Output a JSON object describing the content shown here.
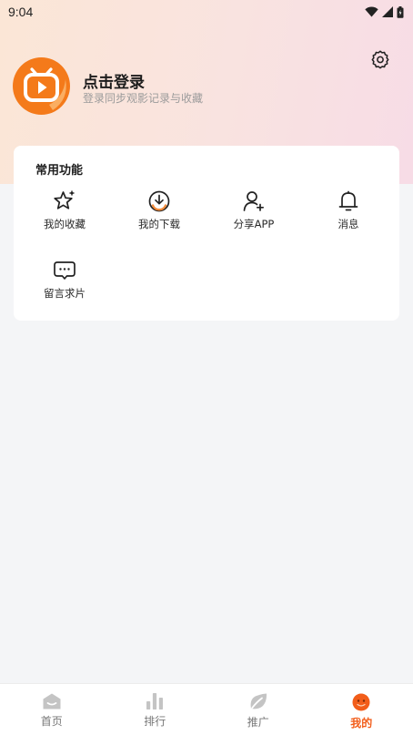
{
  "status_bar": {
    "time": "9:04"
  },
  "header": {
    "login_title": "点击登录",
    "login_subtitle": "登录同步观影记录与收藏"
  },
  "functions": {
    "title": "常用功能",
    "items": [
      {
        "label": "我的收藏",
        "icon": "star-sparkle-icon"
      },
      {
        "label": "我的下载",
        "icon": "download-icon"
      },
      {
        "label": "分享APP",
        "icon": "user-add-icon"
      },
      {
        "label": "消息",
        "icon": "bell-icon"
      },
      {
        "label": "留言求片",
        "icon": "chat-bubble-icon"
      }
    ]
  },
  "tabbar": {
    "items": [
      {
        "label": "首页",
        "icon": "home-icon"
      },
      {
        "label": "排行",
        "icon": "bar-chart-icon"
      },
      {
        "label": "推广",
        "icon": "leaf-icon"
      },
      {
        "label": "我的",
        "icon": "profile-face-icon",
        "active": true
      }
    ]
  },
  "colors": {
    "accent": "#f25d1a",
    "avatar_orange": "#f47a1a",
    "tab_inactive_icon": "#c4c4c4"
  }
}
